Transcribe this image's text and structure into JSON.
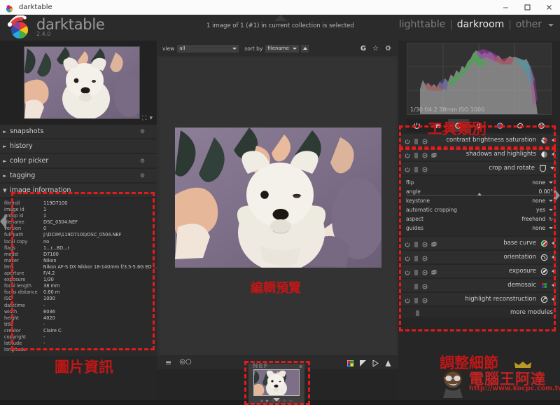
{
  "window": {
    "title": "darktable",
    "controls": {
      "minimize": "minimize-icon",
      "maximize": "maximize-icon",
      "close": "close-icon"
    }
  },
  "header": {
    "brand_name": "darktable",
    "version": "2.4.0",
    "collection_message": "1 image of 1 (#1) in current collection is selected",
    "views": [
      {
        "label": "lighttable",
        "active": false
      },
      {
        "label": "darkroom",
        "active": true
      },
      {
        "label": "other",
        "active": false
      }
    ],
    "view_separator": "|"
  },
  "left_panel": {
    "panels": [
      {
        "label": "snapshots",
        "expanded": false,
        "gear": true
      },
      {
        "label": "history",
        "expanded": false,
        "gear": false
      },
      {
        "label": "color picker",
        "expanded": false,
        "gear": true
      },
      {
        "label": "tagging",
        "expanded": false,
        "gear": true
      },
      {
        "label": "image information",
        "expanded": true,
        "gear": false
      }
    ],
    "image_information": [
      {
        "key": "filmroll",
        "value": "119D7100"
      },
      {
        "key": "image id",
        "value": "1"
      },
      {
        "key": "group id",
        "value": "1"
      },
      {
        "key": "filename",
        "value": "DSC_0504.NEF"
      },
      {
        "key": "version",
        "value": "0"
      },
      {
        "key": "full path",
        "value": "J:\\DCIM\\119D7100/DSC_0504.NEF"
      },
      {
        "key": "local copy",
        "value": "no"
      },
      {
        "key": "flags",
        "value": "1...r...8D...r"
      },
      {
        "key": "model",
        "value": "D7100"
      },
      {
        "key": "maker",
        "value": "Nikon"
      },
      {
        "key": "lens",
        "value": "Nikon AF-S DX Nikkor 18-140mm f/3.5-5.6G ED ..."
      },
      {
        "key": "aperture",
        "value": "F/4.2"
      },
      {
        "key": "exposure",
        "value": "1/30"
      },
      {
        "key": "focal length",
        "value": "38 mm"
      },
      {
        "key": "focus distance",
        "value": "0.60 m"
      },
      {
        "key": "ISO",
        "value": "1000"
      },
      {
        "key": "datetime",
        "value": "-"
      },
      {
        "key": "width",
        "value": "6036"
      },
      {
        "key": "height",
        "value": "4020"
      },
      {
        "key": "title",
        "value": "-"
      },
      {
        "key": "creator",
        "value": "Claire C."
      },
      {
        "key": "copyright",
        "value": "-"
      },
      {
        "key": "latitude",
        "value": "-"
      },
      {
        "key": "longitude",
        "value": "-"
      }
    ]
  },
  "center": {
    "toolbar": {
      "view_label": "view",
      "view_value": "all",
      "sort_label": "sort by",
      "sort_value": "filename",
      "sort_direction": "ascending",
      "right_icons": [
        "G",
        "star-icon",
        "gear-icon"
      ]
    },
    "bottom_icons_left": [
      "hamburger-menu-icon",
      "mask-manager-icon"
    ],
    "bottom_icons_right": [
      "color-assessment-icon",
      "over-under-exposed-icon",
      "gamut-check-icon",
      "softproof-icon"
    ],
    "filmstrip": {
      "filetype_badge": "NEF",
      "reject_label": "x",
      "stars": 5,
      "stars_filled": 0
    }
  },
  "right_panel": {
    "histogram": {
      "info": "1/30 f/4.2 38mm ISO 1000"
    },
    "module_groups": [
      {
        "name": "active-modules-icon",
        "selected": false
      },
      {
        "name": "favorite-modules-icon",
        "selected": false
      },
      {
        "name": "basic-group-icon",
        "selected": true
      },
      {
        "name": "tone-group-icon",
        "selected": false
      },
      {
        "name": "color-group-icon",
        "selected": false
      },
      {
        "name": "correction-group-icon",
        "selected": false
      },
      {
        "name": "effect-group-icon",
        "selected": false
      }
    ],
    "modules": [
      {
        "label": "contrast brightness saturation",
        "expanded": false,
        "icon": "velvia-icon",
        "has_power": true,
        "has_presets": true,
        "has_reset": true,
        "has_multi": false
      },
      {
        "label": "shadows and highlights",
        "expanded": false,
        "icon": "shadows-highlights-icon",
        "has_power": true,
        "has_presets": true,
        "has_reset": true,
        "has_multi": true
      },
      {
        "label": "crop and rotate",
        "expanded": true,
        "icon": "crop-rotate-icon",
        "has_power": true,
        "has_presets": true,
        "has_reset": true,
        "has_multi": false
      },
      {
        "label": "base curve",
        "expanded": false,
        "icon": "base-curve-icon",
        "has_power": true,
        "has_presets": true,
        "has_reset": true,
        "has_multi": true
      },
      {
        "label": "orientation",
        "expanded": false,
        "icon": "orientation-icon",
        "has_power": true,
        "has_presets": true,
        "has_reset": true,
        "has_multi": false
      },
      {
        "label": "exposure",
        "expanded": false,
        "icon": "exposure-icon",
        "has_power": true,
        "has_presets": true,
        "has_reset": true,
        "has_multi": true
      },
      {
        "label": "demosaic",
        "expanded": false,
        "icon": "demosaic-icon",
        "has_power": false,
        "has_presets": true,
        "has_reset": true,
        "has_multi": false
      },
      {
        "label": "highlight reconstruction",
        "expanded": false,
        "icon": "highlight-reconstruction-icon",
        "has_power": true,
        "has_presets": true,
        "has_reset": true,
        "has_multi": false
      }
    ],
    "crop_params": [
      {
        "key": "flip",
        "value": "none",
        "control": "dropdown"
      },
      {
        "key": "angle",
        "value": "0.00°",
        "control": "slider"
      },
      {
        "key": "keystone",
        "value": "none",
        "control": "dropdown"
      },
      {
        "key": "automatic cropping",
        "value": "yes",
        "control": "dropdown"
      },
      {
        "key": "aspect",
        "value": "freehand",
        "control": "refresh"
      },
      {
        "key": "guides",
        "value": "none",
        "control": "dropdown"
      }
    ],
    "more_modules_label": "more modules"
  },
  "annotations": [
    {
      "text": "工具類別",
      "meaning": "tool-categories"
    },
    {
      "text": "編輯預覽",
      "meaning": "edit-preview"
    },
    {
      "text": "圖片資訊",
      "meaning": "image-information"
    },
    {
      "text": "調整細節",
      "meaning": "adjust-details"
    }
  ],
  "watermark": {
    "name": "電腦王阿達",
    "url": "http://www.kocpc.com.tw"
  },
  "colors": {
    "accent_red": "#e21b1b",
    "panel_bg": "#262626",
    "header_bg": "#2b2b2b",
    "canvas_bg": "#333333"
  }
}
